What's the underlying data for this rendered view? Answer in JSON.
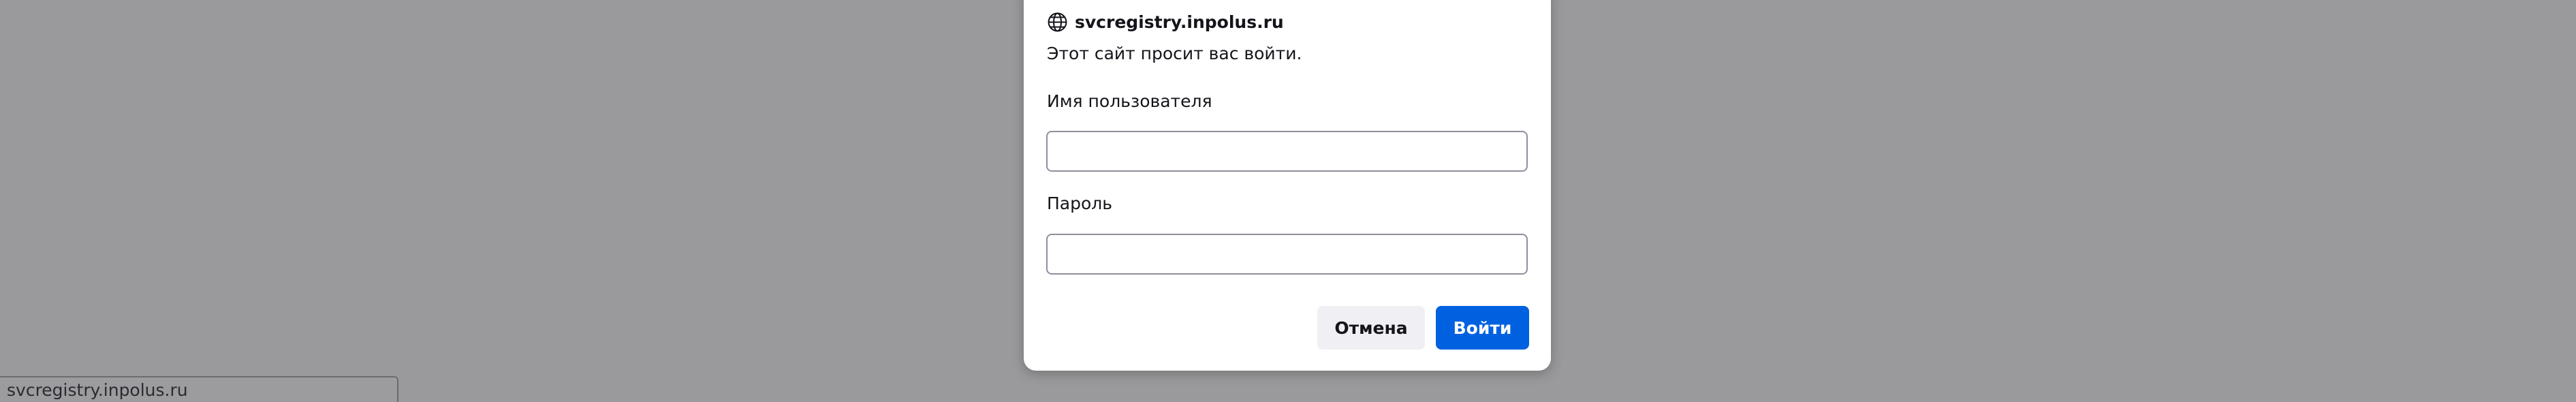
{
  "dialog": {
    "origin": "svcregistry.inpolus.ru",
    "origin_icon": "globe-icon",
    "message": "Этот сайт просит вас войти.",
    "username_label": "Имя пользователя",
    "username_value": "",
    "password_label": "Пароль",
    "password_value": "",
    "cancel_label": "Отмена",
    "login_label": "Войти"
  },
  "statusbar": {
    "text": "svcregistry.inpolus.ru"
  },
  "colors": {
    "backdrop": "#9a9a9c",
    "primary_button": "#0061e0",
    "secondary_button": "#f0f0f4",
    "text": "#15141a"
  }
}
